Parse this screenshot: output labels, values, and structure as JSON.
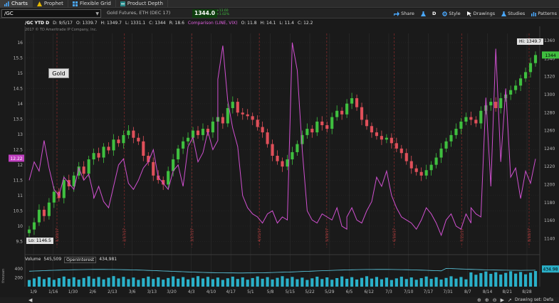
{
  "tabs": [
    {
      "label": "Charts",
      "icon": "chart-icon",
      "active": true
    },
    {
      "label": "Prophet",
      "icon": "warning-icon",
      "active": false
    },
    {
      "label": "Flexible Grid",
      "icon": "grid-icon",
      "active": false
    },
    {
      "label": "Product Depth",
      "icon": "depth-icon",
      "active": false
    }
  ],
  "toolbar": {
    "symbol": "/GC",
    "quote": "Gold Futures, ETH (DEC 17)",
    "price": "1344.0",
    "change_abs": "+13.60",
    "change_pct": "+1.02%",
    "share_label": "Share",
    "aggregation": "D",
    "style_label": "Style",
    "drawings_label": "Drawings",
    "studies_label": "Studies",
    "patterns_label": "Patterns"
  },
  "info": {
    "title": "/GC YTD D",
    "date": "D: 9/5/17",
    "open": "O: 1339.7",
    "high": "H: 1349.7",
    "low": "L: 1331.1",
    "close": "C: 1344",
    "range": "R: 18.6",
    "comparison": "Comparison (LINE, VIX)",
    "c_open": "O: 11.8",
    "c_high": "H: 14.1",
    "c_low": "L: 11.4",
    "c_close": "C: 12.2",
    "copyright": "2017 © TD Ameritrade IP Company, Inc."
  },
  "labels": {
    "gold": "Gold",
    "hi": "Hi: 1349.7",
    "lo": "Lo: 1146.5",
    "vix_tag": "12.22",
    "price_tag": "1344"
  },
  "volume": {
    "label": "Volume",
    "value": "545,509",
    "oi_label": "OpenInterest",
    "oi_value": "434,981",
    "axis_unit": "thousan",
    "tag": "434.98"
  },
  "bottom": {
    "drawing_set": "Drawing set: Defa"
  },
  "colors": {
    "up": "#3fbf3f",
    "down": "#e0505a",
    "vix": "#d050d0",
    "volume": "#2ab0c8",
    "grid": "#2e2e2e"
  },
  "chart_data": {
    "type": "line",
    "title": "/GC YTD D",
    "left_axis": {
      "label": "VIX",
      "ticks": [
        "16",
        "15.5",
        "15",
        "14.5",
        "14",
        "13.5",
        "13",
        "12.5",
        "12",
        "11.5",
        "11",
        "10.5",
        "10",
        "9.5"
      ],
      "range": [
        9.3,
        16.3
      ]
    },
    "right_axis": {
      "label": "Gold",
      "ticks": [
        "1360",
        "1340",
        "1320",
        "1300",
        "1280",
        "1260",
        "1240",
        "1220",
        "1200",
        "1180",
        "1160",
        "1140"
      ],
      "range": [
        1130,
        1368
      ]
    },
    "x_ticks": [
      "1/9",
      "1/16",
      "1/30",
      "2/6",
      "2/13",
      "3/6",
      "3/13",
      "3/20",
      "4/3",
      "4/10",
      "4/17",
      "5/1",
      "5/8",
      "5/15",
      "5/22",
      "5/29",
      "6/5",
      "6/12",
      "7/3",
      "7/10",
      "7/17",
      "7/31",
      "8/7",
      "8/14",
      "8/21",
      "8/28"
    ],
    "vertical_markers": [
      "1/20/17",
      "2/17/17",
      "3/17/17",
      "4/21/17",
      "5/19/17",
      "6/16/17",
      "7/21/17",
      "8/18/17"
    ],
    "series": [
      {
        "name": "Gold",
        "kind": "candlestick",
        "close": [
          1150,
          1158,
          1172,
          1165,
          1180,
          1192,
          1185,
          1205,
          1198,
          1210,
          1220,
          1212,
          1228,
          1235,
          1230,
          1242,
          1238,
          1250,
          1246,
          1255,
          1260,
          1252,
          1248,
          1232,
          1225,
          1210,
          1205,
          1200,
          1215,
          1228,
          1240,
          1248,
          1252,
          1260,
          1255,
          1262,
          1258,
          1270,
          1275,
          1268,
          1285,
          1292,
          1280,
          1278,
          1276,
          1272,
          1264,
          1258,
          1245,
          1232,
          1226,
          1220,
          1228,
          1236,
          1245,
          1255,
          1262,
          1258,
          1270,
          1266,
          1262,
          1275,
          1282,
          1278,
          1290,
          1296,
          1286,
          1272,
          1265,
          1258,
          1254,
          1250,
          1252,
          1246,
          1240,
          1235,
          1226,
          1218,
          1214,
          1210,
          1216,
          1222,
          1230,
          1240,
          1248,
          1255,
          1262,
          1270,
          1275,
          1272,
          1268,
          1282,
          1288,
          1292,
          1285,
          1296,
          1300,
          1305,
          1310,
          1318,
          1325,
          1335,
          1344
        ]
      },
      {
        "name": "VIX",
        "kind": "line",
        "values": [
          11.5,
          12.1,
          11.8,
          12.8,
          11.9,
          11.2,
          11.0,
          11.6,
          11.4,
          11.2,
          11.9,
          11.5,
          11.7,
          11.0,
          10.9,
          11.3,
          10.8,
          10.6,
          11.3,
          12.0,
          12.2,
          11.4,
          11.2,
          11.5,
          11.9,
          12.1,
          12.5,
          11.6,
          11.4,
          11.2,
          11.8,
          12.0,
          11.3,
          12.6,
          12.9,
          12.1,
          12.4,
          13.1,
          12.5,
          12.8,
          14.8,
          15.9,
          14.1,
          13.2,
          12.6,
          11.0,
          10.6,
          10.4,
          10.3,
          10.1,
          10.4,
          10.5,
          10.1,
          10.3,
          10.2,
          16.0,
          15.1,
          12.5,
          10.5,
          10.2,
          10.1,
          10.4,
          10.3,
          10.2,
          10.6,
          10.0,
          9.9,
          10.3,
          10.6,
          10.2,
          10.1,
          10.5,
          10.8,
          11.6,
          11.3,
          11.8,
          11.0,
          10.6,
          10.3,
          10.2,
          10.1,
          9.9,
          10.2,
          10.6,
          10.4,
          10.1,
          9.7,
          10.2,
          10.4,
          10.0,
          9.9,
          10.4,
          10.1,
          10.6,
          10.4,
          10.3,
          14.2,
          11.3,
          15.8,
          12.1,
          14.5,
          11.6,
          11.9,
          10.9,
          11.8,
          11.4,
          12.2
        ]
      },
      {
        "name": "Volume",
        "kind": "bar",
        "unit": "thousand",
        "range": [
          0,
          500
        ]
      }
    ]
  }
}
